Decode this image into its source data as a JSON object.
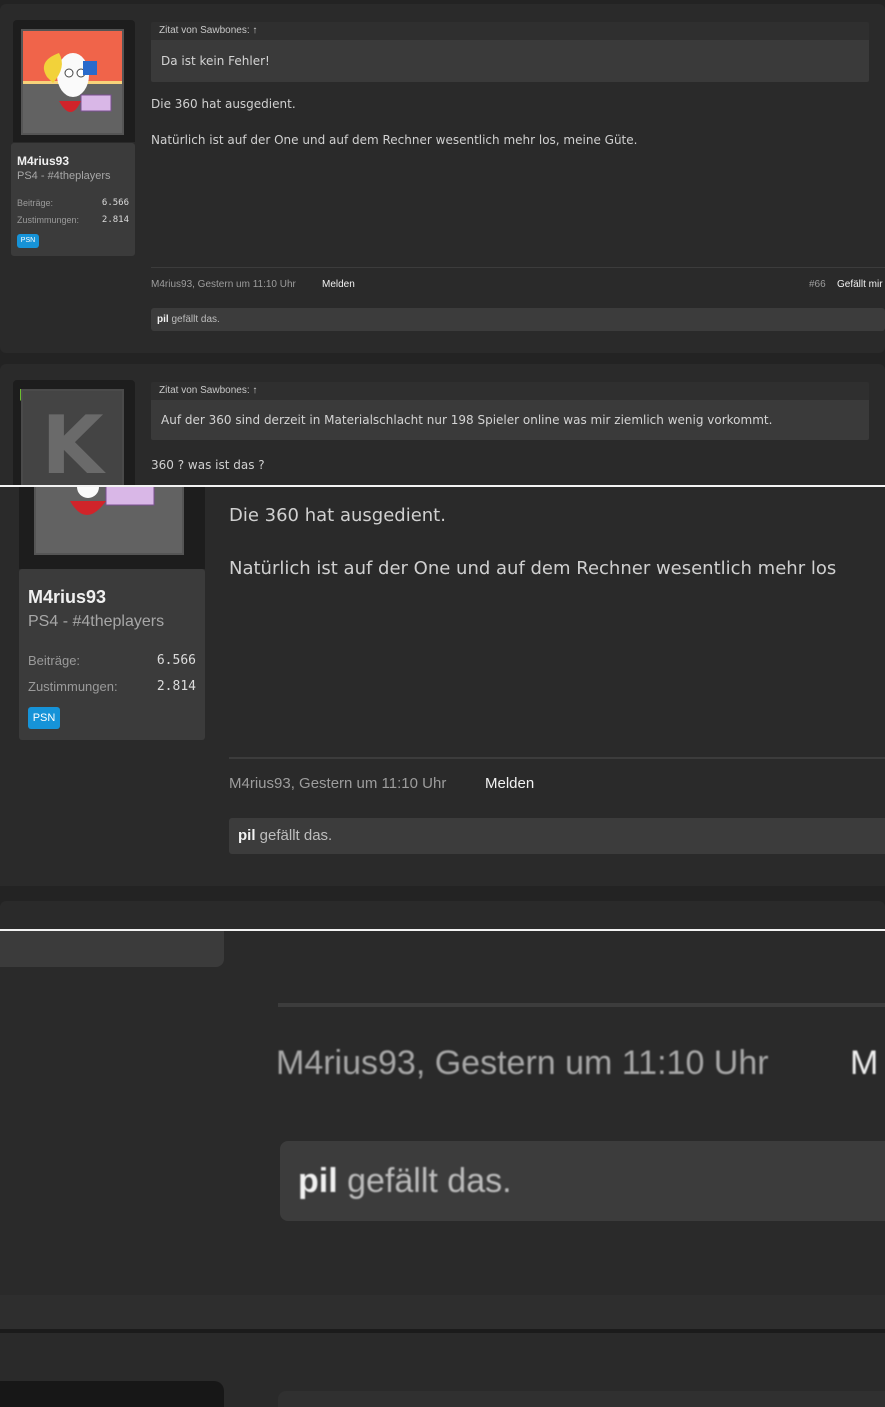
{
  "post1": {
    "username": "M4rius93",
    "user_title": "PS4 - #4theplayers",
    "stats": [
      {
        "label": "Beiträge:",
        "value": "6.566"
      },
      {
        "label": "Zustimmungen:",
        "value": "2.814"
      }
    ],
    "badge": "PSN",
    "quote_header": "Zitat von Sawbones: ↑",
    "quote_text": "Da ist kein Fehler!",
    "message_line1": "Die 360 hat ausgedient.",
    "message_line2": "Natürlich ist auf der One und auf dem Rechner wesentlich mehr los, meine Güte.",
    "author_date": "M4rius93, Gestern um 11:10 Uhr",
    "report": "Melden",
    "post_number": "#66",
    "like_button": "Gefällt mir",
    "liker": "pil",
    "likes_suffix": "gefällt das."
  },
  "post2": {
    "avatar_letter": "K",
    "quote_header": "Zitat von Sawbones: ↑",
    "quote_text": "Auf der 360 sind derzeit in Materialschlacht nur 198 Spieler online was mir ziemlich wenig vorkommt.",
    "message_line1": "360 ? was ist das ?"
  },
  "zoom2": {
    "message_line1": "Die 360 hat ausgedient.",
    "message_line2": "Natürlich ist auf der One und auf dem Rechner wesentlich mehr los",
    "username": "M4rius93",
    "user_title": "PS4 - #4theplayers",
    "stats": [
      {
        "label": "Beiträge:",
        "value": "6.566"
      },
      {
        "label": "Zustimmungen:",
        "value": "2.814"
      }
    ],
    "badge": "PSN",
    "author_date": "M4rius93, Gestern um 11:10 Uhr",
    "report": "Melden",
    "liker": "pil",
    "likes_suffix": "gefällt das."
  },
  "zoom3": {
    "author_date": "M4rius93, Gestern um 11:10 Uhr",
    "report_cut": "M",
    "liker": "pil",
    "likes_suffix": "gefällt das."
  },
  "colors": {
    "background": "#232323",
    "post_background": "#2a2a2a",
    "badge_psn": "#1693d8",
    "avatar_orange": "#f0644a"
  }
}
